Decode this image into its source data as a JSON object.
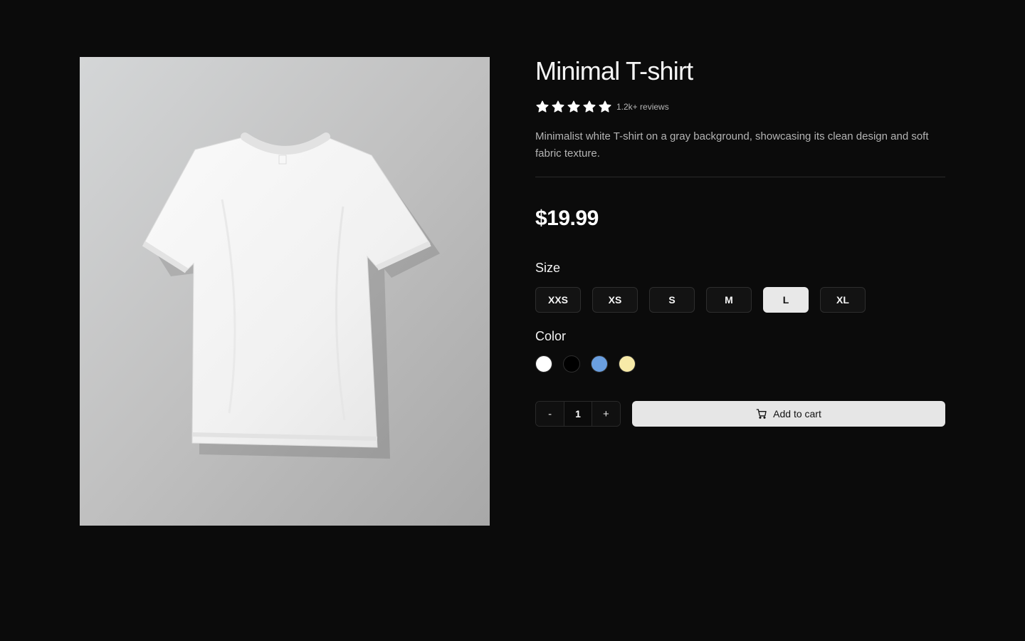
{
  "product": {
    "title": "Minimal T-shirt",
    "rating": {
      "stars": 5,
      "reviews_text": "1.2k+ reviews"
    },
    "description": "Minimalist white T-shirt on a gray background, showcasing its clean design and soft fabric texture.",
    "price": "$19.99",
    "image": {
      "icon": "tshirt-photo",
      "background_color": "#c4c4c4"
    }
  },
  "size": {
    "label": "Size",
    "options": [
      "XXS",
      "XS",
      "S",
      "M",
      "L",
      "XL"
    ],
    "selected": "L"
  },
  "color": {
    "label": "Color",
    "options": [
      {
        "name": "white",
        "hex": "#ffffff"
      },
      {
        "name": "black",
        "hex": "#000000"
      },
      {
        "name": "blue",
        "hex": "#6a9fe0"
      },
      {
        "name": "yellow",
        "hex": "#f7eaa8"
      }
    ]
  },
  "cart": {
    "decrement_label": "-",
    "quantity": "1",
    "increment_label": "+",
    "add_label": "Add to cart"
  },
  "colors": {
    "background": "#0b0b0b",
    "button_light": "#e6e6e6"
  }
}
